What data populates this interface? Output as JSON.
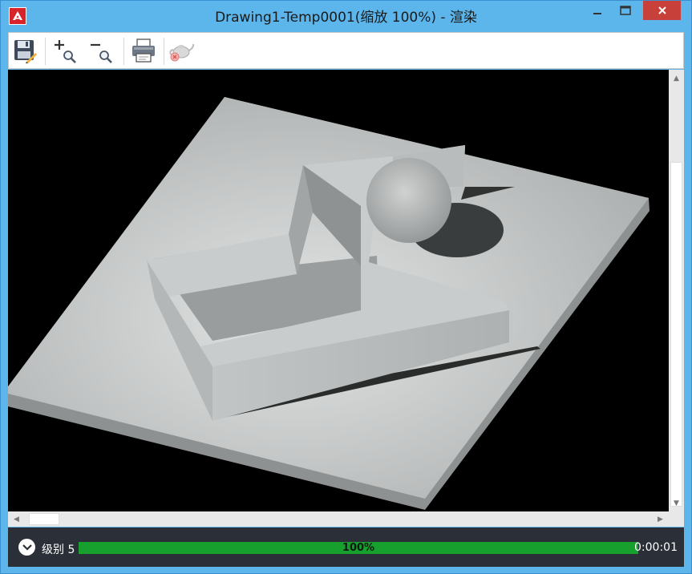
{
  "window": {
    "title": "Drawing1-Temp0001(缩放 100%) - 渲染"
  },
  "title_bar": {
    "app_icon": "autocad-logo-icon",
    "buttons": [
      {
        "name": "minimize",
        "icon": "minimize-icon"
      },
      {
        "name": "maximize",
        "icon": "maximize-icon"
      },
      {
        "name": "close",
        "icon": "close-icon",
        "color": "#c7403a"
      }
    ]
  },
  "toolbar": {
    "items": [
      {
        "name": "save",
        "icon": "save-icon"
      },
      {
        "name": "zoom-in",
        "icon": "zoom-in-icon"
      },
      {
        "name": "zoom-out",
        "icon": "zoom-out-icon"
      },
      {
        "name": "print",
        "icon": "print-icon"
      },
      {
        "name": "render",
        "icon": "teapot-render-icon",
        "state": "disabled"
      }
    ]
  },
  "render_view": {
    "content": "rendered 3D model: gray base plate with stepped wall shape and sphere",
    "background_color": "#000000"
  },
  "status_bar": {
    "level_label": "级别 5",
    "progress_text": "100%",
    "progress_value": 1.0,
    "progress_color": "#17a02e",
    "time_text": "0:00:01"
  }
}
